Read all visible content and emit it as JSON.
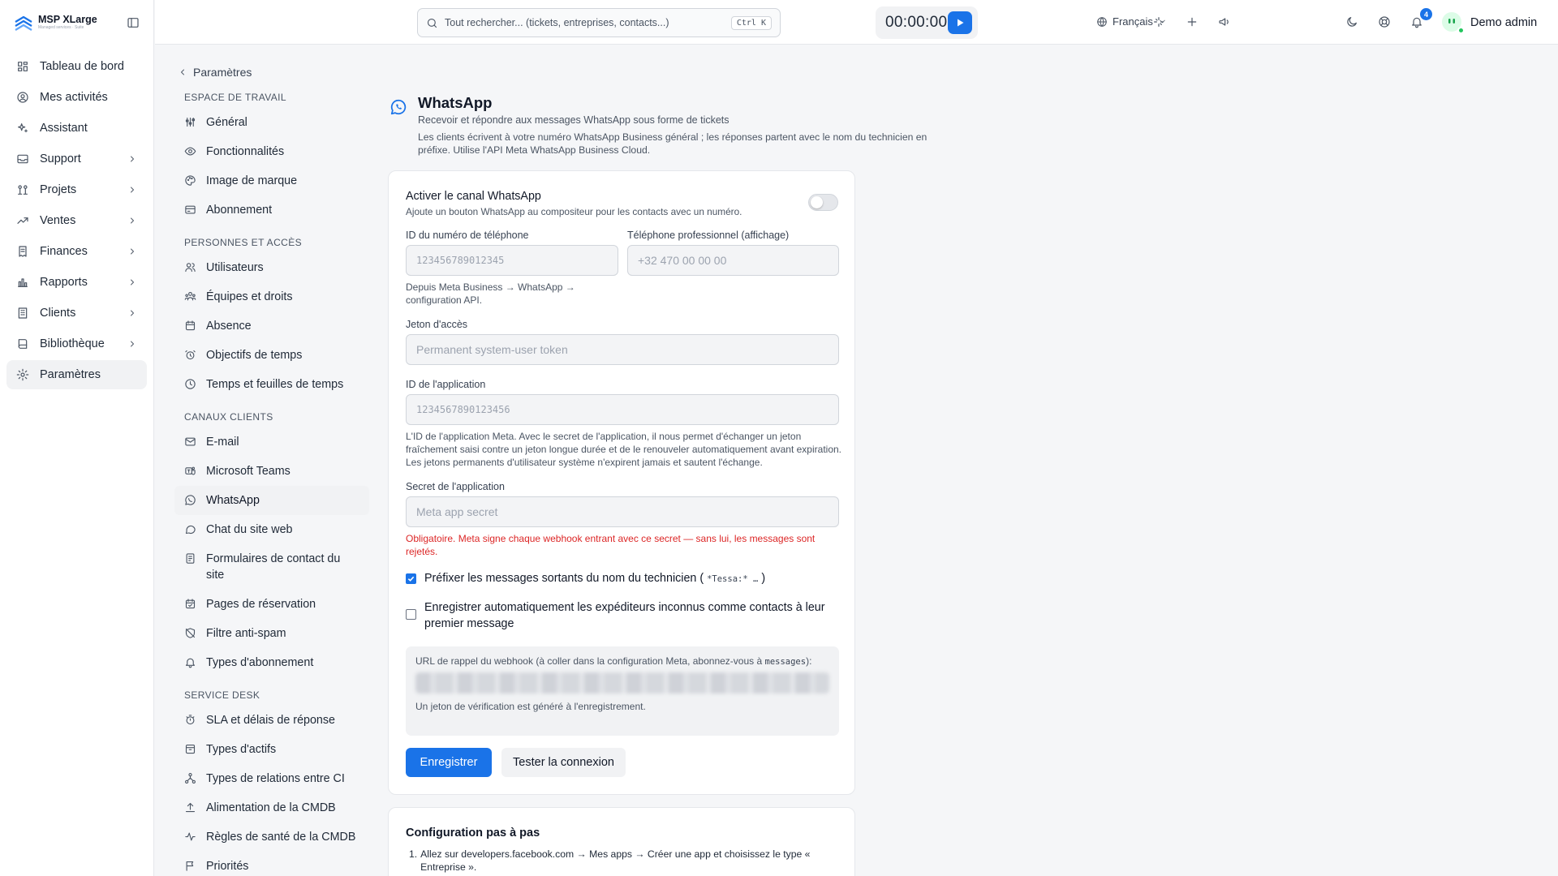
{
  "brand": {
    "name": "MSP XLarge",
    "tagline": "Managed services · Suite"
  },
  "colors": {
    "accent": "#1a73e8",
    "danger": "#dc2626",
    "success": "#22c55e"
  },
  "sidebar": {
    "items": [
      {
        "label": "Tableau de bord",
        "icon": "dashboard-icon"
      },
      {
        "label": "Mes activités",
        "icon": "user-circle-icon"
      },
      {
        "label": "Assistant",
        "icon": "sparkles-icon"
      },
      {
        "label": "Support",
        "icon": "inbox-icon"
      },
      {
        "label": "Projets",
        "icon": "projects-icon"
      },
      {
        "label": "Ventes",
        "icon": "trend-icon"
      },
      {
        "label": "Finances",
        "icon": "receipt-icon"
      },
      {
        "label": "Rapports",
        "icon": "bar-chart-icon"
      },
      {
        "label": "Clients",
        "icon": "building-icon"
      },
      {
        "label": "Bibliothèque",
        "icon": "book-icon"
      },
      {
        "label": "Paramètres",
        "icon": "gear-icon"
      }
    ]
  },
  "topbar": {
    "search_placeholder": "Tout rechercher... (tickets, entreprises, contacts...)",
    "search_shortcut": "Ctrl K",
    "timer": "00:00:00",
    "language": "Français",
    "notification_count": "4",
    "user_name": "Demo admin"
  },
  "settings_nav": {
    "back_label": "Paramètres",
    "sections": [
      {
        "title": "ESPACE DE TRAVAIL",
        "items": [
          "Général",
          "Fonctionnalités",
          "Image de marque",
          "Abonnement"
        ]
      },
      {
        "title": "PERSONNES ET ACCÈS",
        "items": [
          "Utilisateurs",
          "Équipes et droits",
          "Absence",
          "Objectifs de temps",
          "Temps et feuilles de temps"
        ]
      },
      {
        "title": "CANAUX CLIENTS",
        "items": [
          "E-mail",
          "Microsoft Teams",
          "WhatsApp",
          "Chat du site web",
          "Formulaires de contact du site",
          "Pages de réservation",
          "Filtre anti-spam",
          "Types d'abonnement"
        ]
      },
      {
        "title": "SERVICE DESK",
        "items": [
          "SLA et délais de réponse",
          "Types d'actifs",
          "Types de relations entre CI",
          "Alimentation de la CMDB",
          "Règles de santé de la CMDB",
          "Priorités"
        ]
      }
    ]
  },
  "page": {
    "title": "WhatsApp",
    "subtitle": "Recevoir et répondre aux messages WhatsApp sous forme de tickets",
    "description": "Les clients écrivent à votre numéro WhatsApp Business général ; les réponses partent avec le nom du technicien en préfixe. Utilise l'API Meta WhatsApp Business Cloud."
  },
  "form": {
    "enable_title": "Activer le canal WhatsApp",
    "enable_desc": "Ajoute un bouton WhatsApp au compositeur pour les contacts avec un numéro.",
    "enabled": false,
    "phone_id_label": "ID du numéro de téléphone",
    "phone_id_placeholder": "123456789012345",
    "phone_id_help": "Depuis Meta Business → WhatsApp → configuration API.",
    "business_phone_label": "Téléphone professionnel (affichage)",
    "business_phone_placeholder": "+32 470 00 00 00",
    "token_label": "Jeton d'accès",
    "token_placeholder": "Permanent system-user token",
    "app_id_label": "ID de l'application",
    "app_id_placeholder": "1234567890123456",
    "app_id_help": "L'ID de l'application Meta. Avec le secret de l'application, il nous permet d'échanger un jeton fraîchement saisi contre un jeton longue durée et de le renouveler automatiquement avant expiration. Les jetons permanents d'utilisateur système n'expirent jamais et sautent l'échange.",
    "secret_label": "Secret de l'application",
    "secret_placeholder": "Meta app secret",
    "secret_warning": "Obligatoire. Meta signe chaque webhook entrant avec ce secret — sans lui, les messages sont rejetés.",
    "prefix_label_before": "Préfixer les messages sortants du nom du technicien (",
    "prefix_code": "*Tessa:* …",
    "prefix_label_after": ")",
    "prefix_checked": true,
    "autosave_label": "Enregistrer automatiquement les expéditeurs inconnus comme contacts à leur premier message",
    "autosave_checked": false,
    "webhook_intro": "URL de rappel du webhook (à coller dans la configuration Meta, abonnez-vous à",
    "webhook_code": "messages",
    "webhook_intro_end": "):",
    "webhook_note": "Un jeton de vérification est généré à l'enregistrement.",
    "save_label": "Enregistrer",
    "test_label": "Tester la connexion"
  },
  "steps": {
    "title": "Configuration pas à pas",
    "items": [
      "Allez sur developers.facebook.com → Mes apps → Créer une app et choisissez le type « Entreprise »."
    ]
  }
}
